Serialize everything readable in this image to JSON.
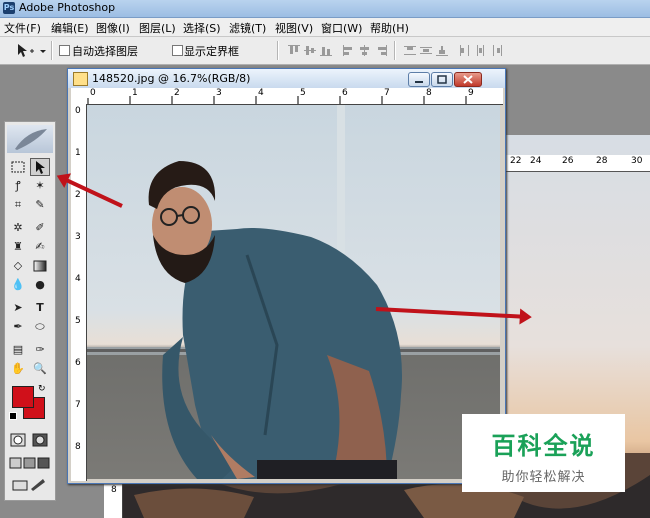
{
  "app": {
    "title": "Adobe Photoshop",
    "icon": "photoshop-app-icon"
  },
  "menu": [
    "文件(F)",
    "编辑(E)",
    "图像(I)",
    "图层(L)",
    "选择(S)",
    "滤镜(T)",
    "视图(V)",
    "窗口(W)",
    "帮助(H)"
  ],
  "options": {
    "auto_select_label": "自动选择图层",
    "show_bounds_label": "显示定界框"
  },
  "document": {
    "title": "148520.jpg @ 16.7%(RGB/8)",
    "h_ruler_ticks": [
      "0",
      "1",
      "2",
      "3",
      "4",
      "5",
      "6",
      "7",
      "8",
      "9"
    ],
    "v_ruler_ticks": [
      "0",
      "1",
      "2",
      "3",
      "4",
      "5",
      "6",
      "7",
      "8"
    ]
  },
  "background_document": {
    "h_ruler_ticks": [
      "22",
      "24",
      "26",
      "28",
      "30"
    ],
    "v_ruler_ticks": [
      "8"
    ]
  },
  "toolbox": {
    "foreground_color": "#d0101a",
    "background_color": "#d0101a"
  },
  "annotation_color": "#c0121a",
  "watermark": {
    "title": "百科全说",
    "subtitle": "助你轻松解决",
    "color": "#1aa158"
  }
}
